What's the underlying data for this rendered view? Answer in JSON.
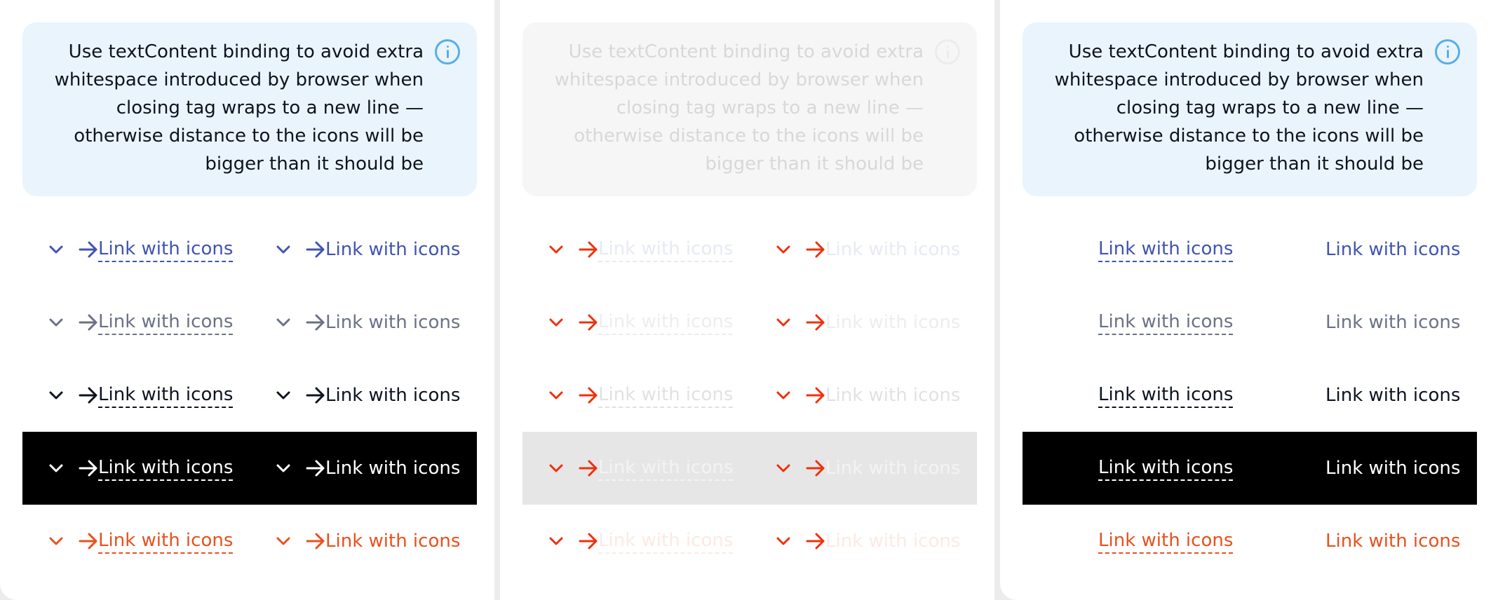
{
  "note": {
    "text": "Use textContent binding to avoid extra whitespace introduced by browser when closing tag wraps to a new line — otherwise distance to the icons will be bigger than it should be",
    "icon": "info-circle-icon"
  },
  "link_label": "Link with icons",
  "icons": {
    "chevron": "chevron-down-icon",
    "arrow": "arrow-right-icon"
  },
  "colors": {
    "brand": "#4054b2",
    "gray": "#6b7186",
    "dark": "#0e1320",
    "inverse": "#ffffff",
    "accent": "#e8511d",
    "icon_red": "#f0300a",
    "note_bg": "#eaf4fd",
    "info": "#57aee9"
  }
}
